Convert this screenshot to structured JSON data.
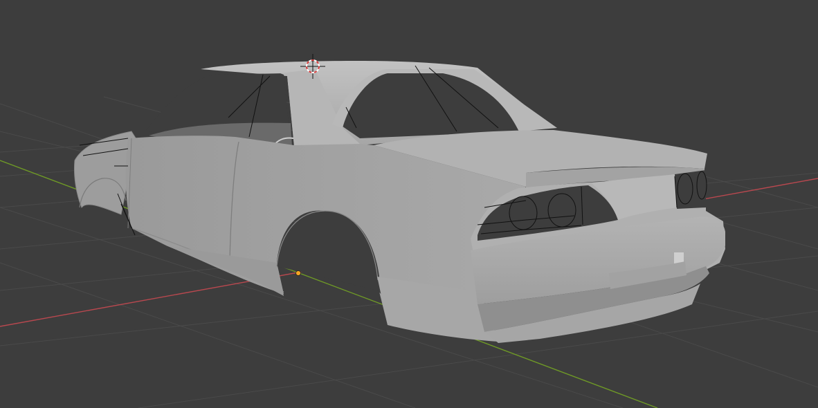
{
  "viewport": {
    "background": "#3d3d3d",
    "grid_color": "#4a4a4a",
    "x_axis_color": "#b9484f",
    "y_axis_color": "#6f9a26",
    "mesh_color": "#a8a8a8",
    "wire_color": "#111111",
    "cursor_color": "#d43a3a",
    "origin_color": "#f5a623",
    "icons": {
      "cursor": "3d-cursor-icon",
      "origin": "object-origin-icon"
    }
  }
}
